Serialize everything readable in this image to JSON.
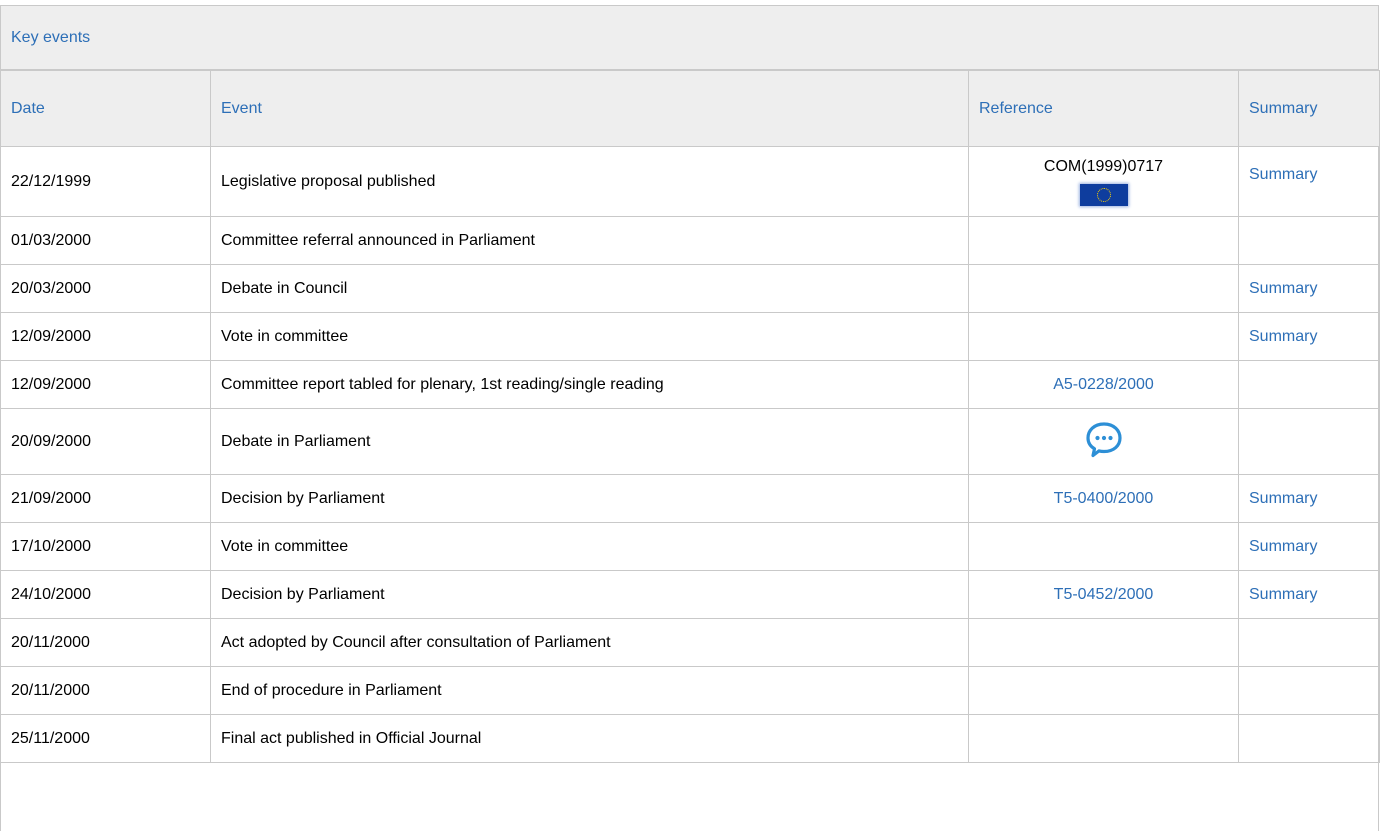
{
  "panel": {
    "title": "Key events"
  },
  "columns": {
    "date": "Date",
    "event": "Event",
    "reference": "Reference",
    "summary": "Summary"
  },
  "rows": [
    {
      "date": "22/12/1999",
      "event": "Legislative proposal published",
      "reference": "COM(1999)0717",
      "reference_icon": "eu-flag-icon",
      "summary": "Summary"
    },
    {
      "date": "01/03/2000",
      "event": "Committee referral announced in Parliament",
      "reference": "",
      "summary": ""
    },
    {
      "date": "20/03/2000",
      "event": "Debate in Council",
      "reference": "",
      "summary": "Summary"
    },
    {
      "date": "12/09/2000",
      "event": "Vote in committee",
      "reference": "",
      "summary": "Summary"
    },
    {
      "date": "12/09/2000",
      "event": "Committee report tabled for plenary, 1st reading/single reading",
      "reference": "A5-0228/2000",
      "summary": ""
    },
    {
      "date": "20/09/2000",
      "event": "Debate in Parliament",
      "reference": "",
      "reference_icon": "speech-bubble-icon",
      "summary": ""
    },
    {
      "date": "21/09/2000",
      "event": "Decision by Parliament",
      "reference": "T5-0400/2000",
      "summary": "Summary"
    },
    {
      "date": "17/10/2000",
      "event": "Vote in committee",
      "reference": "",
      "summary": "Summary"
    },
    {
      "date": "24/10/2000",
      "event": "Decision by Parliament",
      "reference": "T5-0452/2000",
      "summary": "Summary"
    },
    {
      "date": "20/11/2000",
      "event": "Act adopted by Council after consultation of Parliament",
      "reference": "",
      "summary": ""
    },
    {
      "date": "20/11/2000",
      "event": "End of procedure in Parliament",
      "reference": "",
      "summary": ""
    },
    {
      "date": "25/11/2000",
      "event": "Final act published in Official Journal",
      "reference": "",
      "summary": ""
    }
  ],
  "colors": {
    "link": "#2d6fb7",
    "header_bg": "#eeeeee",
    "border": "#c9c9c9",
    "eu_blue": "#0e3d9e"
  }
}
